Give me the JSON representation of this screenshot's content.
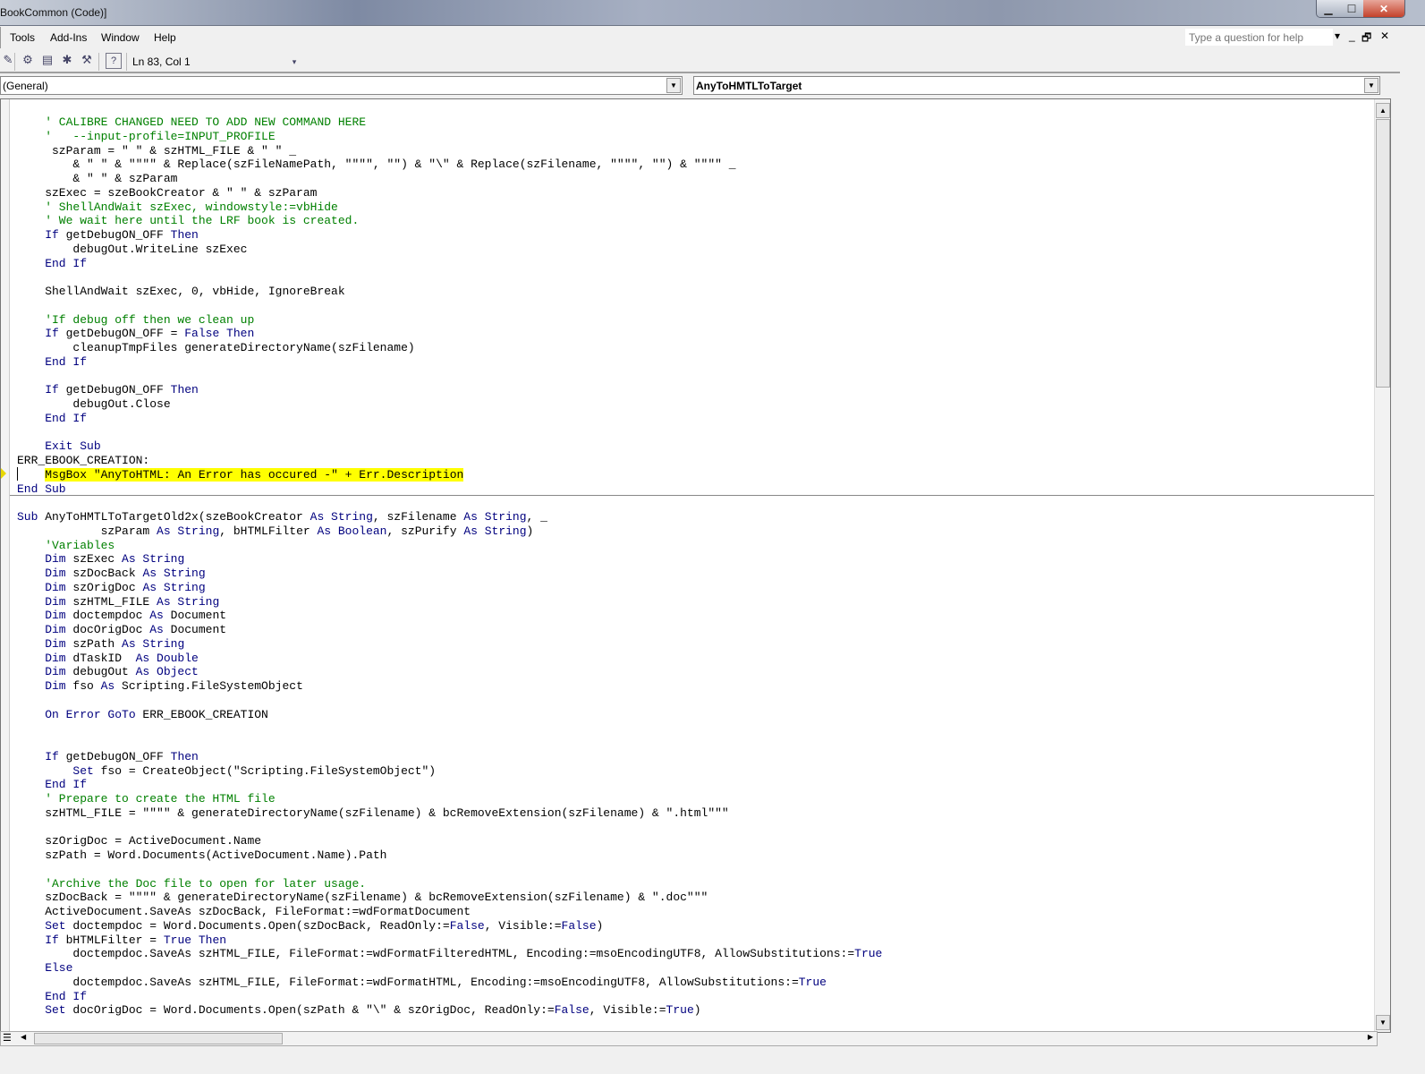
{
  "window": {
    "title": "BookCommon (Code)]",
    "minimize": "▁",
    "maximize": "☐",
    "close": "✕"
  },
  "menu": [
    "Tools",
    "Add-Ins",
    "Window",
    "Help"
  ],
  "help": {
    "placeholder": "Type a question for help",
    "dropdown": "▾",
    "min": "_",
    "restore": "🗗",
    "close": "✕"
  },
  "toolbar": {
    "icons": [
      "✎",
      "⚙",
      "▤",
      "✱",
      "⚒"
    ],
    "help_icon": "?",
    "position": "Ln 83, Col 1",
    "overflow": "▾"
  },
  "object_combo": {
    "value": "(General)"
  },
  "proc_combo": {
    "value": "AnyToHMTLToTarget"
  },
  "code": {
    "lines": [
      [
        [
          "c",
          "    ' CALIBRE CHANGED NEED TO ADD NEW COMMAND HERE"
        ]
      ],
      [
        [
          "c",
          "    '   --input-profile=INPUT_PROFILE"
        ]
      ],
      [
        [
          "n",
          "     szParam = \" \" & szHTML_FILE & \" \" _"
        ]
      ],
      [
        [
          "n",
          "        & \" \" & \"\"\"\" & Replace(szFileNamePath, \"\"\"\", \"\") & \"\\\" & Replace(szFilename, \"\"\"\", \"\") & \"\"\"\" _"
        ]
      ],
      [
        [
          "n",
          "        & \" \" & szParam"
        ]
      ],
      [
        [
          "n",
          "    szExec = szeBookCreator & \" \" & szParam"
        ]
      ],
      [
        [
          "c",
          "    ' ShellAndWait szExec, windowstyle:=vbHide"
        ]
      ],
      [
        [
          "c",
          "    ' We wait here until the LRF book is created."
        ]
      ],
      [
        [
          "k",
          "    If"
        ],
        [
          "n",
          " getDebugON_OFF "
        ],
        [
          "k",
          "Then"
        ]
      ],
      [
        [
          "n",
          "        debugOut.WriteLine szExec"
        ]
      ],
      [
        [
          "k",
          "    End If"
        ]
      ],
      [],
      [
        [
          "n",
          "    ShellAndWait szExec, 0, vbHide, IgnoreBreak"
        ]
      ],
      [],
      [
        [
          "c",
          "    'If debug off then we clean up"
        ]
      ],
      [
        [
          "k",
          "    If"
        ],
        [
          "n",
          " getDebugON_OFF = "
        ],
        [
          "k",
          "False Then"
        ]
      ],
      [
        [
          "n",
          "        cleanupTmpFiles generateDirectoryName(szFilename)"
        ]
      ],
      [
        [
          "k",
          "    End If"
        ]
      ],
      [],
      [
        [
          "k",
          "    If"
        ],
        [
          "n",
          " getDebugON_OFF "
        ],
        [
          "k",
          "Then"
        ]
      ],
      [
        [
          "n",
          "        debugOut.Close"
        ]
      ],
      [
        [
          "k",
          "    End If"
        ]
      ],
      [],
      [
        [
          "k",
          "    Exit Sub"
        ]
      ],
      [
        [
          "n",
          "ERR_EBOOK_CREATION:"
        ]
      ],
      [
        [
          "n",
          "    "
        ],
        [
          "h",
          "MsgBox \"AnyToHTML: An Error has occured -\" + Err.Description"
        ]
      ],
      [
        [
          "k",
          "End Sub"
        ]
      ],
      [],
      [
        [
          "k",
          "Sub"
        ],
        [
          "n",
          " AnyToHMTLToTargetOld2x(szeBookCreator "
        ],
        [
          "k",
          "As String"
        ],
        [
          "n",
          ", szFilename "
        ],
        [
          "k",
          "As String"
        ],
        [
          "n",
          ", _"
        ]
      ],
      [
        [
          "n",
          "            szParam "
        ],
        [
          "k",
          "As String"
        ],
        [
          "n",
          ", bHTMLFilter "
        ],
        [
          "k",
          "As Boolean"
        ],
        [
          "n",
          ", szPurify "
        ],
        [
          "k",
          "As String"
        ],
        [
          "n",
          ")"
        ]
      ],
      [
        [
          "c",
          "    'Variables"
        ]
      ],
      [
        [
          "k",
          "    Dim"
        ],
        [
          "n",
          " szExec "
        ],
        [
          "k",
          "As String"
        ]
      ],
      [
        [
          "k",
          "    Dim"
        ],
        [
          "n",
          " szDocBack "
        ],
        [
          "k",
          "As String"
        ]
      ],
      [
        [
          "k",
          "    Dim"
        ],
        [
          "n",
          " szOrigDoc "
        ],
        [
          "k",
          "As String"
        ]
      ],
      [
        [
          "k",
          "    Dim"
        ],
        [
          "n",
          " szHTML_FILE "
        ],
        [
          "k",
          "As String"
        ]
      ],
      [
        [
          "k",
          "    Dim"
        ],
        [
          "n",
          " doctempdoc "
        ],
        [
          "k",
          "As"
        ],
        [
          "n",
          " Document"
        ]
      ],
      [
        [
          "k",
          "    Dim"
        ],
        [
          "n",
          " docOrigDoc "
        ],
        [
          "k",
          "As"
        ],
        [
          "n",
          " Document"
        ]
      ],
      [
        [
          "k",
          "    Dim"
        ],
        [
          "n",
          " szPath "
        ],
        [
          "k",
          "As String"
        ]
      ],
      [
        [
          "k",
          "    Dim"
        ],
        [
          "n",
          " dTaskID  "
        ],
        [
          "k",
          "As Double"
        ]
      ],
      [
        [
          "k",
          "    Dim"
        ],
        [
          "n",
          " debugOut "
        ],
        [
          "k",
          "As Object"
        ]
      ],
      [
        [
          "k",
          "    Dim"
        ],
        [
          "n",
          " fso "
        ],
        [
          "k",
          "As"
        ],
        [
          "n",
          " Scripting.FileSystemObject"
        ]
      ],
      [],
      [
        [
          "k",
          "    On Error GoTo"
        ],
        [
          "n",
          " ERR_EBOOK_CREATION"
        ]
      ],
      [],
      [],
      [
        [
          "k",
          "    If"
        ],
        [
          "n",
          " getDebugON_OFF "
        ],
        [
          "k",
          "Then"
        ]
      ],
      [
        [
          "k",
          "        Set"
        ],
        [
          "n",
          " fso = CreateObject(\"Scripting.FileSystemObject\")"
        ]
      ],
      [
        [
          "k",
          "    End If"
        ]
      ],
      [
        [
          "c",
          "    ' Prepare to create the HTML file"
        ]
      ],
      [
        [
          "n",
          "    szHTML_FILE = \"\"\"\" & generateDirectoryName(szFilename) & bcRemoveExtension(szFilename) & \".html\"\"\""
        ]
      ],
      [],
      [
        [
          "n",
          "    szOrigDoc = ActiveDocument.Name"
        ]
      ],
      [
        [
          "n",
          "    szPath = Word.Documents(ActiveDocument.Name).Path"
        ]
      ],
      [],
      [
        [
          "c",
          "    'Archive the Doc file to open for later usage."
        ]
      ],
      [
        [
          "n",
          "    szDocBack = \"\"\"\" & generateDirectoryName(szFilename) & bcRemoveExtension(szFilename) & \".doc\"\"\""
        ]
      ],
      [
        [
          "n",
          "    ActiveDocument.SaveAs szDocBack, FileFormat:=wdFormatDocument"
        ]
      ],
      [
        [
          "k",
          "    Set"
        ],
        [
          "n",
          " doctempdoc = Word.Documents.Open(szDocBack, ReadOnly:="
        ],
        [
          "k",
          "False"
        ],
        [
          "n",
          ", Visible:="
        ],
        [
          "k",
          "False"
        ],
        [
          "n",
          ")"
        ]
      ],
      [
        [
          "k",
          "    If"
        ],
        [
          "n",
          " bHTMLFilter = "
        ],
        [
          "k",
          "True Then"
        ]
      ],
      [
        [
          "n",
          "        doctempdoc.SaveAs szHTML_FILE, FileFormat:=wdFormatFilteredHTML, Encoding:=msoEncodingUTF8, AllowSubstitutions:="
        ],
        [
          "k",
          "True"
        ]
      ],
      [
        [
          "k",
          "    Else"
        ]
      ],
      [
        [
          "n",
          "        doctempdoc.SaveAs szHTML_FILE, FileFormat:=wdFormatHTML, Encoding:=msoEncodingUTF8, AllowSubstitutions:="
        ],
        [
          "k",
          "True"
        ]
      ],
      [
        [
          "k",
          "    End If"
        ]
      ],
      [
        [
          "k",
          "    Set"
        ],
        [
          "n",
          " docOrigDoc = Word.Documents.Open(szPath & \"\\\" & szOrigDoc, ReadOnly:="
        ],
        [
          "k",
          "False"
        ],
        [
          "n",
          ", Visible:="
        ],
        [
          "k",
          "True"
        ],
        [
          "n",
          ")"
        ]
      ]
    ]
  },
  "colors": {
    "keyword": "#00007f",
    "comment": "#008000",
    "highlight": "#ffff00"
  }
}
